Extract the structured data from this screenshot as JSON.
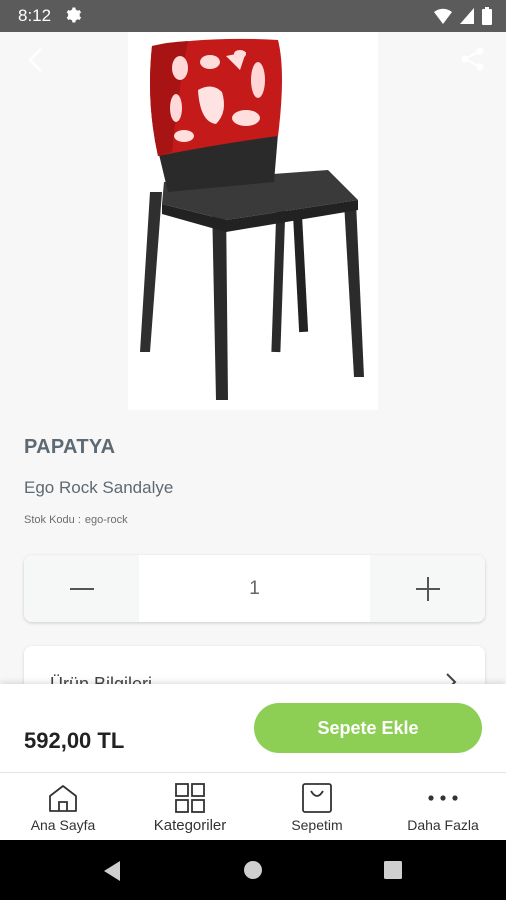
{
  "status_bar": {
    "time": "8:12"
  },
  "product": {
    "brand": "PAPATYA",
    "name": "Ego Rock Sandalye",
    "stock_label": "Stok Kodu :",
    "stock_code": "ego-rock",
    "quantity": "1",
    "info_label": "Ürün Bilgileri",
    "price": "592,00 TL",
    "add_to_cart": "Sepete Ekle"
  },
  "colors": {
    "accent": "#8dcf55",
    "chair_back": "#c41a1a",
    "chair_body": "#2b2b2b"
  },
  "bottom_nav": [
    {
      "label": "Ana Sayfa",
      "icon": "home-icon"
    },
    {
      "label": "Kategoriler",
      "icon": "grid-icon"
    },
    {
      "label": "Sepetim",
      "icon": "bag-icon"
    },
    {
      "label": "Daha Fazla",
      "icon": "more-icon"
    }
  ]
}
